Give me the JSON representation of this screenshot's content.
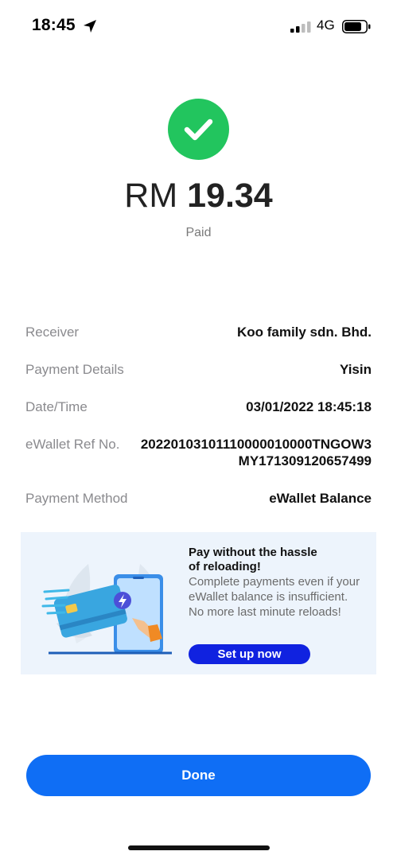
{
  "status_bar": {
    "time": "18:45",
    "network": "4G",
    "icons": [
      "location-arrow-icon",
      "signal-icon",
      "battery-icon"
    ]
  },
  "payment": {
    "currency": "RM",
    "amount": "19.34",
    "status": "Paid",
    "success_icon": "check-circle-icon",
    "success_color": "#22c55e"
  },
  "details": {
    "receiver_label": "Receiver",
    "receiver_value": "Koo family sdn. Bhd.",
    "payment_details_label": "Payment Details",
    "payment_details_value": "Yisin",
    "datetime_label": "Date/Time",
    "datetime_value": "03/01/2022 18:45:18",
    "ref_label": "eWallet Ref No.",
    "ref_value_line1": "20220103101110000010000TNGOW3",
    "ref_value_line2": "MY171309120657499",
    "method_label": "Payment Method",
    "method_value": "eWallet Balance"
  },
  "banner": {
    "title_line1": "Pay without the hassle",
    "title_line2": "of reloading!",
    "body_line1": "Complete payments even if your",
    "body_line2": "eWallet balance is insufficient.",
    "body_line3": "No more last minute reloads!",
    "cta_label": "Set up now",
    "cta_color": "#1022e0"
  },
  "footer": {
    "done_label": "Done",
    "done_color": "#0f6ef5"
  }
}
